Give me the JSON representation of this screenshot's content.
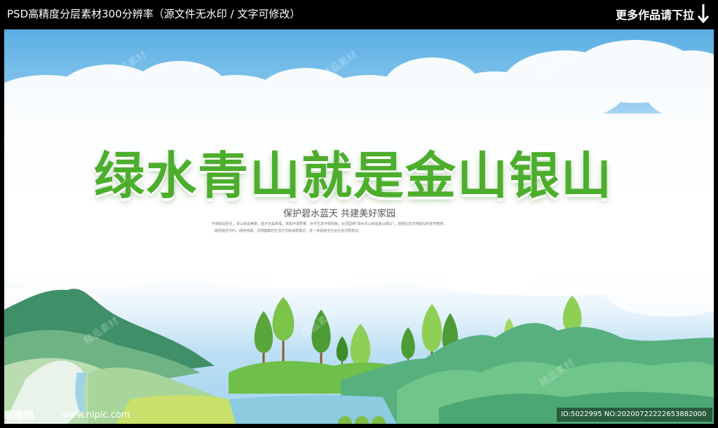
{
  "topbar": {
    "left_text": "PSD高精度分层素材300分辨率（源文件无水印 / 文字可修改）",
    "right_text": "更多作品请下拉",
    "arrow_icon": "down-arrow-icon"
  },
  "poster": {
    "title": "绿水青山就是金山银山",
    "subtitle": "保护碧水蓝天  共建美好家园",
    "body_line_1": "环境就是民生，青山就是美丽，蓝天也是幸福。改善环境质量，补齐生态环保短板，必须坚持“绿水青山就是金山银山”，加强生态文明建设的宣传教育，",
    "body_line_2": "倡导勤俭节约、绿色低碳、文明健康的生活方式和消费模式，进一步提高全社会生态文明意识。",
    "watermark": "精品素材",
    "colors": {
      "title_green": "#4cae2c",
      "sky_blue": "#5aaee3",
      "mountain_green": "#6cc06a"
    }
  },
  "footer": {
    "logo": "昵图网",
    "url": "www.nipic.com",
    "id_text": "ID:5022995 NO:20200722222653882000"
  }
}
